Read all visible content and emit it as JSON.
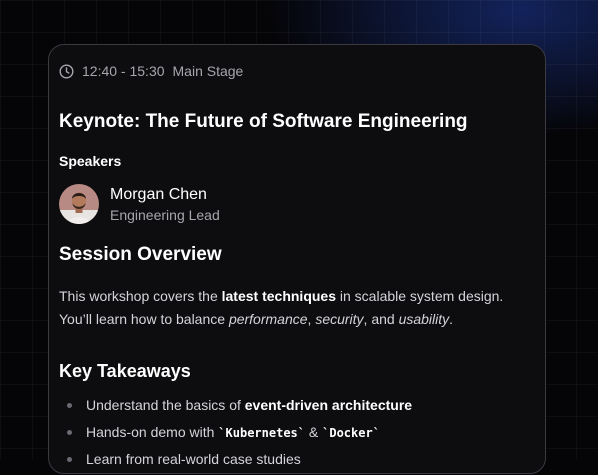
{
  "session": {
    "time": "12:40 - 15:30",
    "location": "Main Stage",
    "title": "Keynote: The Future of Software Engineering"
  },
  "speakers": {
    "label": "Speakers",
    "items": [
      {
        "name": "Morgan Chen",
        "role": "Engineering Lead"
      }
    ]
  },
  "overview": {
    "heading": "Session Overview",
    "p1_pre": "This workshop covers the ",
    "p1_bold": "latest techniques",
    "p1_post": " in scalable system design.",
    "p2_pre": "You’ll learn how to balance ",
    "p2_em1": "performance",
    "p2_sep1": ", ",
    "p2_em2": "security",
    "p2_sep2": ", and ",
    "p2_em3": "usability",
    "p2_end": "."
  },
  "takeaways": {
    "heading": "Key Takeaways",
    "item1_pre": "Understand the basics of ",
    "item1_bold": "event-driven architecture",
    "item2_pre": "Hands-on demo with ",
    "item2_code1": "`Kubernetes`",
    "item2_mid": " & ",
    "item2_code2": "`Docker`",
    "item3": "Learn from real-world case studies"
  },
  "icons": {
    "clock": "clock-icon",
    "avatar": "speaker-avatar"
  },
  "colors": {
    "background": "#050508",
    "card": "#0d0d10",
    "card_border": "#3a3a40",
    "muted_text": "#a6a6ad",
    "glow": "#1e3ca0"
  }
}
